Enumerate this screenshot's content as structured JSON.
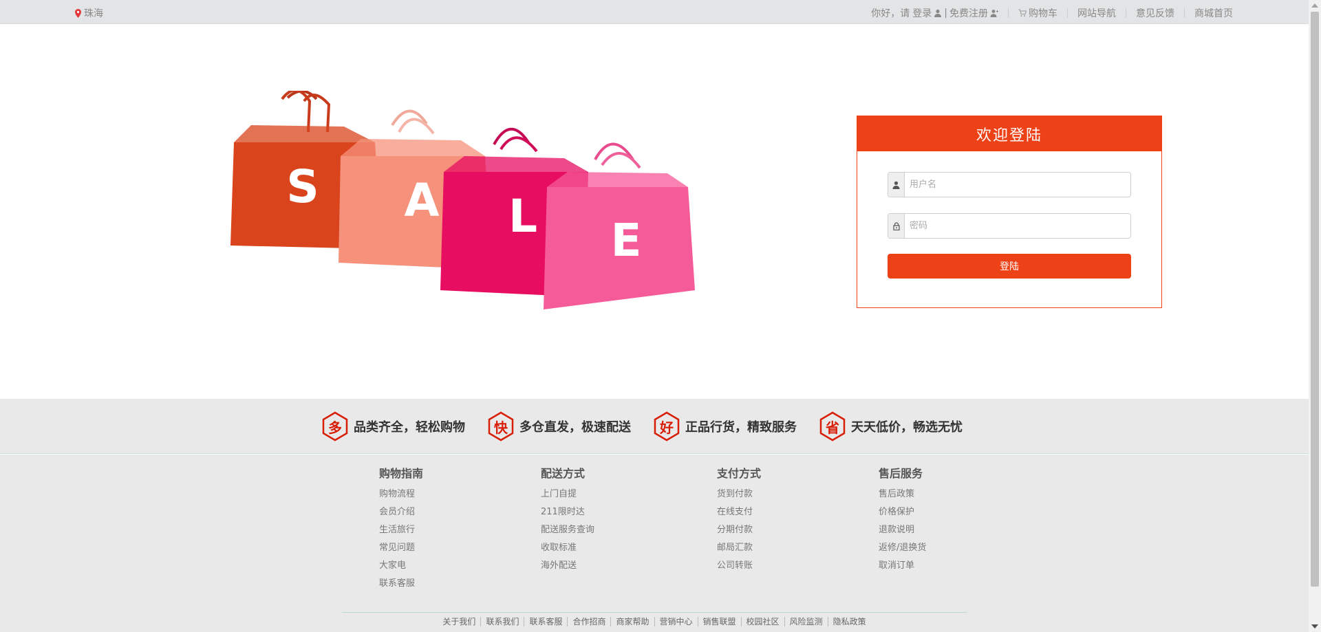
{
  "topbar": {
    "location": "珠海",
    "greeting": "你好，请",
    "login": "登录",
    "divider": "|",
    "register": "免费注册",
    "cart": "购物车",
    "site_nav": "网站导航",
    "feedback": "意见反馈",
    "home": "商城首页"
  },
  "hero": {
    "bag_letters": [
      "S",
      "A",
      "L",
      "E"
    ],
    "bag_colors": [
      "#d9441c",
      "#f6917c",
      "#e70e61",
      "#f55a99"
    ]
  },
  "login": {
    "title": "欢迎登陆",
    "username_placeholder": "用户名",
    "password_placeholder": "密码",
    "submit": "登陆",
    "accent": "#ed4117"
  },
  "features": [
    {
      "badge": "多",
      "text": "品类齐全，轻松购物"
    },
    {
      "badge": "快",
      "text": "多仓直发，极速配送"
    },
    {
      "badge": "好",
      "text": "正品行货，精致服务"
    },
    {
      "badge": "省",
      "text": "天天低价，畅选无忧"
    }
  ],
  "footer": {
    "columns": [
      {
        "title": "购物指南",
        "items": [
          "购物流程",
          "会员介绍",
          "生活旅行",
          "常见问题",
          "大家电",
          "联系客服"
        ]
      },
      {
        "title": "配送方式",
        "items": [
          "上门自提",
          "211限时达",
          "配送服务查询",
          "收取标准",
          "海外配送"
        ]
      },
      {
        "title": "支付方式",
        "items": [
          "货到付款",
          "在线支付",
          "分期付款",
          "邮局汇款",
          "公司转账"
        ]
      },
      {
        "title": "售后服务",
        "items": [
          "售后政策",
          "价格保护",
          "退款说明",
          "返修/退换货",
          "取消订单"
        ]
      }
    ],
    "bottom_links": [
      "关于我们",
      "联系我们",
      "联系客服",
      "合作招商",
      "商家帮助",
      "营销中心",
      "销售联盟",
      "校园社区",
      "风险监测",
      "隐私政策"
    ]
  }
}
